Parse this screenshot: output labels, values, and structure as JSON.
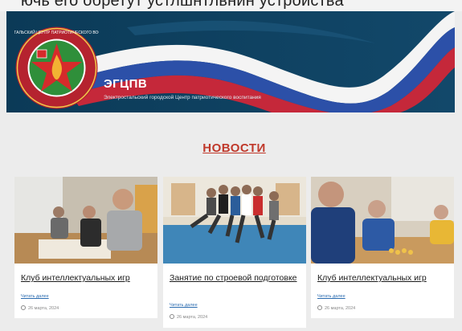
{
  "top_strip_text": "ючь его обретут устлшнтлвнин устройства",
  "header": {
    "site_name": "ЭГЦПВ",
    "site_description": "Электростальский городской Центр патриотического воспитания",
    "logo_ring_text": "ЭЛЕКТРОСТАЛЬСКИЙ ЦЕНТР ПАТРИОТИЧЕСКОГО ВОСПИТАНИЯ"
  },
  "news_section": {
    "title": "НОВОСТИ",
    "cards": [
      {
        "title": "Клуб интеллектуальных игр",
        "read_more": "Читать далее",
        "date": "26 марта, 2024"
      },
      {
        "title": "Занятие по строевой подготовке",
        "read_more": "Читать далее",
        "date": "26 марта, 2024"
      },
      {
        "title": "Клуб интеллектуальных игр",
        "read_more": "Читать далее",
        "date": "26 марта, 2024"
      }
    ]
  },
  "colors": {
    "header_bg": "#0e3f5e",
    "news_title": "#c0392b",
    "link": "#2b6cb0",
    "page_bg": "#ececec"
  }
}
